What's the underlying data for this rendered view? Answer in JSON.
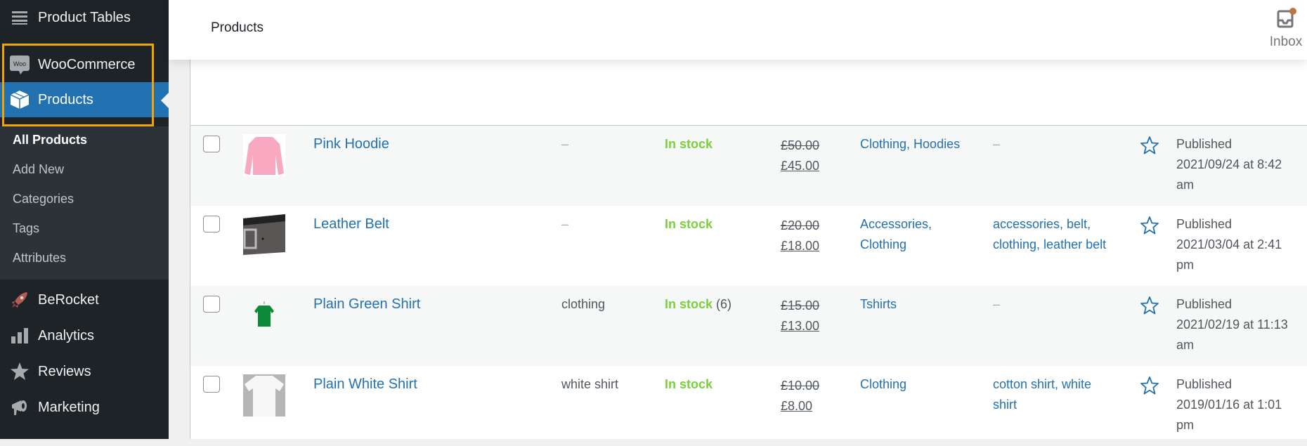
{
  "sidebar": {
    "items": [
      {
        "label": "Product Tables",
        "icon": "menu-lines-icon"
      },
      {
        "label": "WooCommerce",
        "icon": "woo-icon"
      },
      {
        "label": "Products",
        "icon": "box-icon",
        "active": true
      },
      {
        "label": "BeRocket",
        "icon": "rocket-icon"
      },
      {
        "label": "Analytics",
        "icon": "bar-chart-icon"
      },
      {
        "label": "Reviews",
        "icon": "star-icon"
      },
      {
        "label": "Marketing",
        "icon": "megaphone-icon"
      }
    ],
    "submenu": [
      {
        "label": "All Products",
        "current": true
      },
      {
        "label": "Add New"
      },
      {
        "label": "Categories"
      },
      {
        "label": "Tags"
      },
      {
        "label": "Attributes"
      }
    ],
    "highlight_color": "#f0a500",
    "active_color": "#2271b1"
  },
  "header": {
    "title": "Products",
    "inbox_label": "Inbox",
    "inbox_badge_color": "#c0704a"
  },
  "products": [
    {
      "name": "Pink Hoodie",
      "thumb": "pink-hoodie",
      "sku": "–",
      "stock_status": "In stock",
      "stock_qty": "",
      "price_old": "£50.00",
      "price_new": "£45.00",
      "categories": "Clothing, Hoodies",
      "tags": "–",
      "date_status": "Published",
      "date": "2021/09/24 at 8:42 am"
    },
    {
      "name": "Leather Belt",
      "thumb": "leather-belt",
      "sku": "–",
      "stock_status": "In stock",
      "stock_qty": "",
      "price_old": "£20.00",
      "price_new": "£18.00",
      "categories": "Accessories, Clothing",
      "tags": "accessories, belt, clothing, leather belt",
      "date_status": "Published",
      "date": "2021/03/04 at 2:41 pm"
    },
    {
      "name": "Plain Green Shirt",
      "thumb": "green-shirt",
      "sku": "clothing",
      "stock_status": "In stock",
      "stock_qty": "(6)",
      "price_old": "£15.00",
      "price_new": "£13.00",
      "categories": "Tshirts",
      "tags": "–",
      "date_status": "Published",
      "date": "2021/02/19 at 11:13 am"
    },
    {
      "name": "Plain White Shirt",
      "thumb": "white-shirt",
      "sku": "white shirt",
      "stock_status": "In stock",
      "stock_qty": "",
      "price_old": "£10.00",
      "price_new": "£8.00",
      "categories": "Clothing",
      "tags": "cotton shirt, white shirt",
      "date_status": "Published",
      "date": "2019/01/16 at 1:01 pm"
    }
  ]
}
